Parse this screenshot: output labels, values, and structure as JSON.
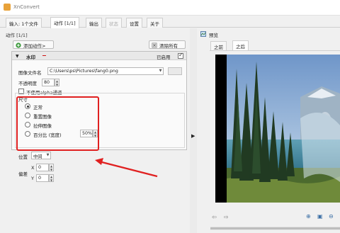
{
  "window": {
    "title": "XnConvert"
  },
  "tabs": [
    {
      "label": "输入: 1个文件",
      "state": "normal"
    },
    {
      "label": "动作 [1/1]",
      "state": "active"
    },
    {
      "label": "输出",
      "state": "normal"
    },
    {
      "label": "状态",
      "state": "disabled"
    },
    {
      "label": "设置",
      "state": "normal"
    },
    {
      "label": "关于",
      "state": "normal"
    }
  ],
  "actions_panel": {
    "label": "动作 [1/1]",
    "add_button": "添加动作>",
    "clear_button": "清除所有",
    "action": {
      "name": "水印",
      "enabled_label": "已启用",
      "enabled": true,
      "image_file_label": "图像文件名",
      "image_file_value": "C:\\Users\\ps\\Pictures\\fang0.png",
      "opacity_label": "不透明度",
      "opacity_value": "80",
      "no_alpha_label": "不使用alpha通道",
      "size_group": {
        "label": "尺寸",
        "options": [
          "正常",
          "重置图像",
          "拉伸图像",
          "百分比 (宽度)"
        ],
        "selected": 0,
        "percent_value": "50%"
      },
      "position_label": "位置",
      "position_value": "中间",
      "offset_label": "偏差",
      "x_label": "X",
      "x_value": "0",
      "y_label": "Y",
      "y_value": "0"
    }
  },
  "preview": {
    "label": "预览",
    "tabs": [
      "之前",
      "之后"
    ],
    "active_tab": 1
  },
  "colors": {
    "highlight": "#e02020",
    "accent": "#e8a23a"
  }
}
